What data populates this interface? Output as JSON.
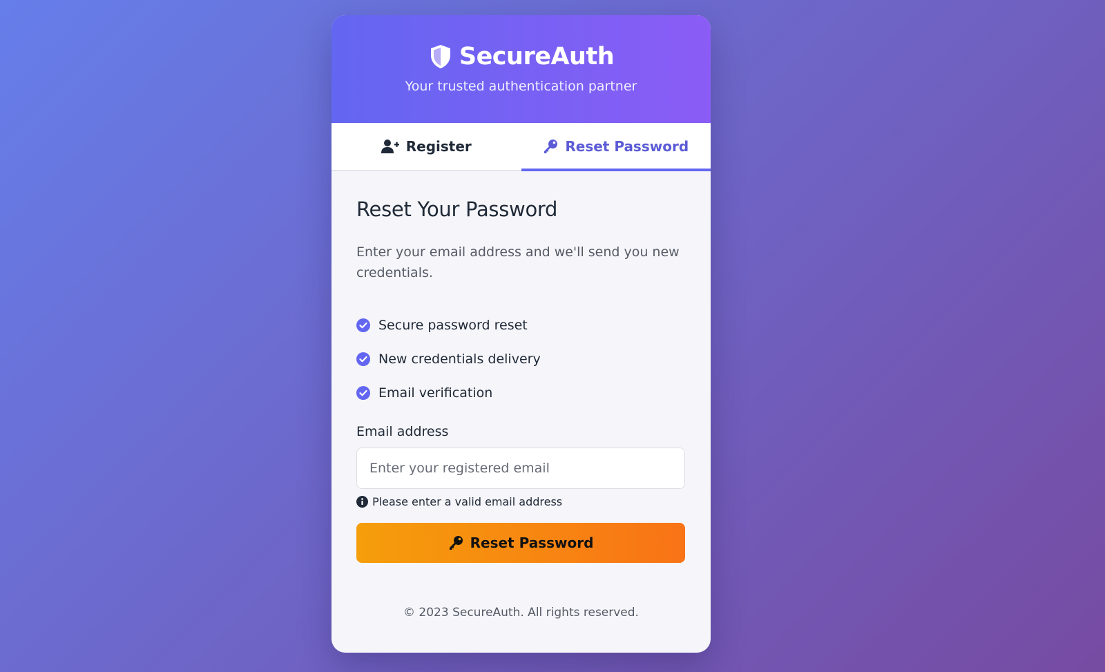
{
  "brand": {
    "name": "SecureAuth",
    "tagline": "Your trusted authentication partner",
    "icon": "shield-icon"
  },
  "tabs": [
    {
      "label": "Register",
      "icon": "user-plus-icon",
      "active": false
    },
    {
      "label": "Reset Password",
      "icon": "key-icon",
      "active": true
    }
  ],
  "form": {
    "title": "Reset Your Password",
    "description": "Enter your email address and we'll send you new credentials.",
    "features": [
      "Secure password reset",
      "New credentials delivery",
      "Email verification"
    ],
    "email_label": "Email address",
    "email_value": "",
    "email_placeholder": "Enter your registered email",
    "hint": "Please enter a valid email address",
    "submit_label": "Reset Password"
  },
  "footer": {
    "text": "© 2023 SecureAuth. All rights reserved."
  },
  "colors": {
    "primary": "#6366f1",
    "accent_start": "#f59e0b",
    "accent_end": "#f97316",
    "background_start": "#667eea",
    "background_end": "#764ba2"
  }
}
